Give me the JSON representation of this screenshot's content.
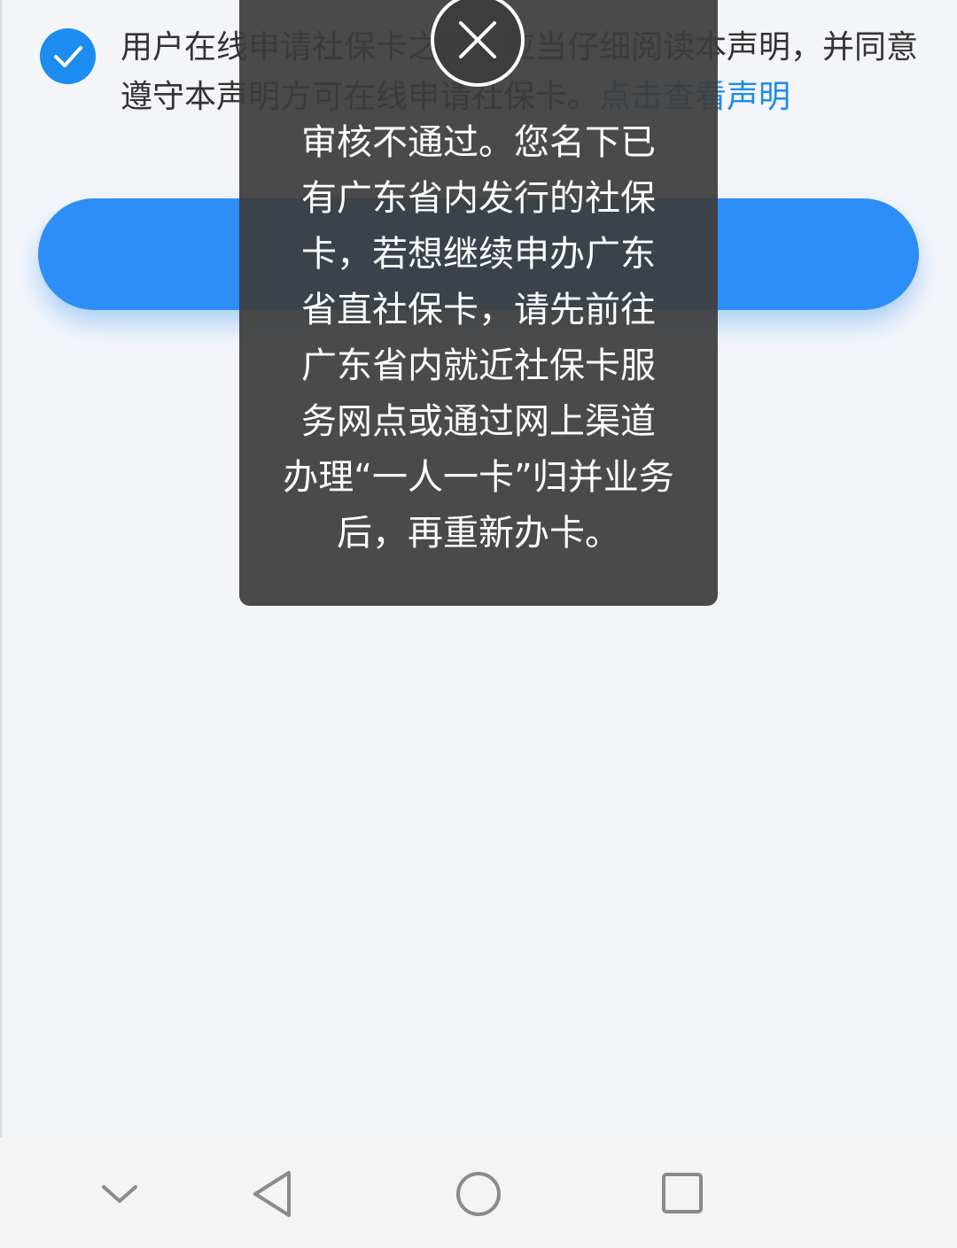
{
  "agreement": {
    "line1": "用户在线申请社保卡之前，应当仔细阅读本声明，并同意",
    "line2_text": "遵守本声明方可在线申请社保卡。",
    "link_text": "点击查看声明",
    "checked": true
  },
  "toast": {
    "message_lines": [
      "审核不通过。您名下已",
      "有广东省内发行的社保",
      "卡，若想继续申办广东",
      "省直社保卡，请先前往",
      "广东省内就近社保卡服",
      "务网点或通过网上渠道",
      "办理“一人一卡”归并业务",
      "后，再重新办卡。"
    ],
    "close_icon": "close-icon"
  },
  "nav": {
    "icons": [
      "chevron-down-icon",
      "back-triangle-icon",
      "home-circle-icon",
      "recents-square-icon"
    ]
  },
  "colors": {
    "accent": "#1c8cf0",
    "button": "#2e8ef7",
    "toast_bg": "#3c3c3c",
    "page_bg": "#f4f5f9"
  }
}
